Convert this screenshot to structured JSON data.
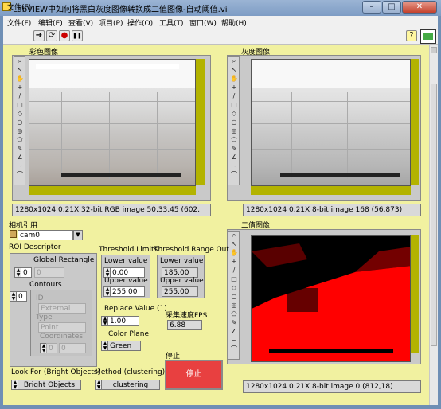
{
  "window": {
    "title": "LabVIEW中如何将黑白灰度图像转换成二值图像-自动阈值.vi",
    "min": "–",
    "max": "□",
    "close": "✕"
  },
  "menu": [
    "文件(F)",
    "编辑(E)",
    "查看(V)",
    "项目(P)",
    "操作(O)",
    "工具(T)",
    "窗口(W)",
    "帮助(H)"
  ],
  "toolbar": {
    "run": "➔",
    "run_cont": "⟳",
    "abort": "●",
    "pause": "❚❚",
    "help": "?"
  },
  "palette_icons": [
    "zoom-icon",
    "pointer-icon",
    "pan-icon",
    "crosshair-icon",
    "line-icon",
    "rectangle-icon",
    "rotated-rect-icon",
    "oval-icon",
    "annulus-icon",
    "polygon-icon",
    "freehand-icon",
    "broken-line-icon",
    "free-line-icon",
    "polyline-icon"
  ],
  "palette_glyphs": [
    "⌕",
    "↖",
    "✋",
    "+",
    "/",
    "□",
    "◇",
    "○",
    "◎",
    "⬠",
    "✎",
    "∠",
    "~",
    "⌒"
  ],
  "color_image": {
    "label": "彩色图像",
    "status": "1280x1024 0.21X 32-bit RGB image 50,33,45    (602,"
  },
  "gray_image": {
    "label": "灰度图像",
    "status": "1280x1024 0.21X 8-bit image 168    (56,873)"
  },
  "binary_image": {
    "label": "二值图像",
    "status": "1280x1024 0.21X 8-bit image 0    (812,18)"
  },
  "camera": {
    "label": "相机引用",
    "value": "cam0",
    "icon": "camera-icon"
  },
  "roi": {
    "label": "ROI Descriptor",
    "global_rect": "Global Rectangle",
    "global_index": "0",
    "global_value": "0",
    "contours": "Contours",
    "contour_index": "0",
    "id": "ID",
    "external": "External",
    "type": "Type",
    "point": "Point",
    "coordinates": "Coordinates",
    "coord_index": "0",
    "coord_value": "0"
  },
  "threshold_limits": {
    "label": "Threshold Limits",
    "lower_label": "Lower value",
    "lower": "0.00",
    "upper_label": "Upper value",
    "upper": "255.00"
  },
  "threshold_range": {
    "label": "Threshold Range Out",
    "lower_label": "Lower value",
    "lower": "185.00",
    "upper_label": "Upper value",
    "upper": "255.00"
  },
  "replace": {
    "label": "Replace Value (1)",
    "value": "1.00"
  },
  "color_plane": {
    "label": "Color Plane",
    "value": "Green"
  },
  "fps": {
    "label": "采集速度FPS",
    "value": "6.88"
  },
  "stop": {
    "label": "停止",
    "button": "停止"
  },
  "look_for": {
    "label": "Look For (Bright Objects)",
    "value": "Bright Objects"
  },
  "method": {
    "label": "Method (clustering)",
    "value": "clustering"
  },
  "colors": {
    "panel": "#f1f1a0",
    "olive": "#b3b300",
    "binary_red": "#ff0000",
    "stop_red": "#e84040"
  }
}
